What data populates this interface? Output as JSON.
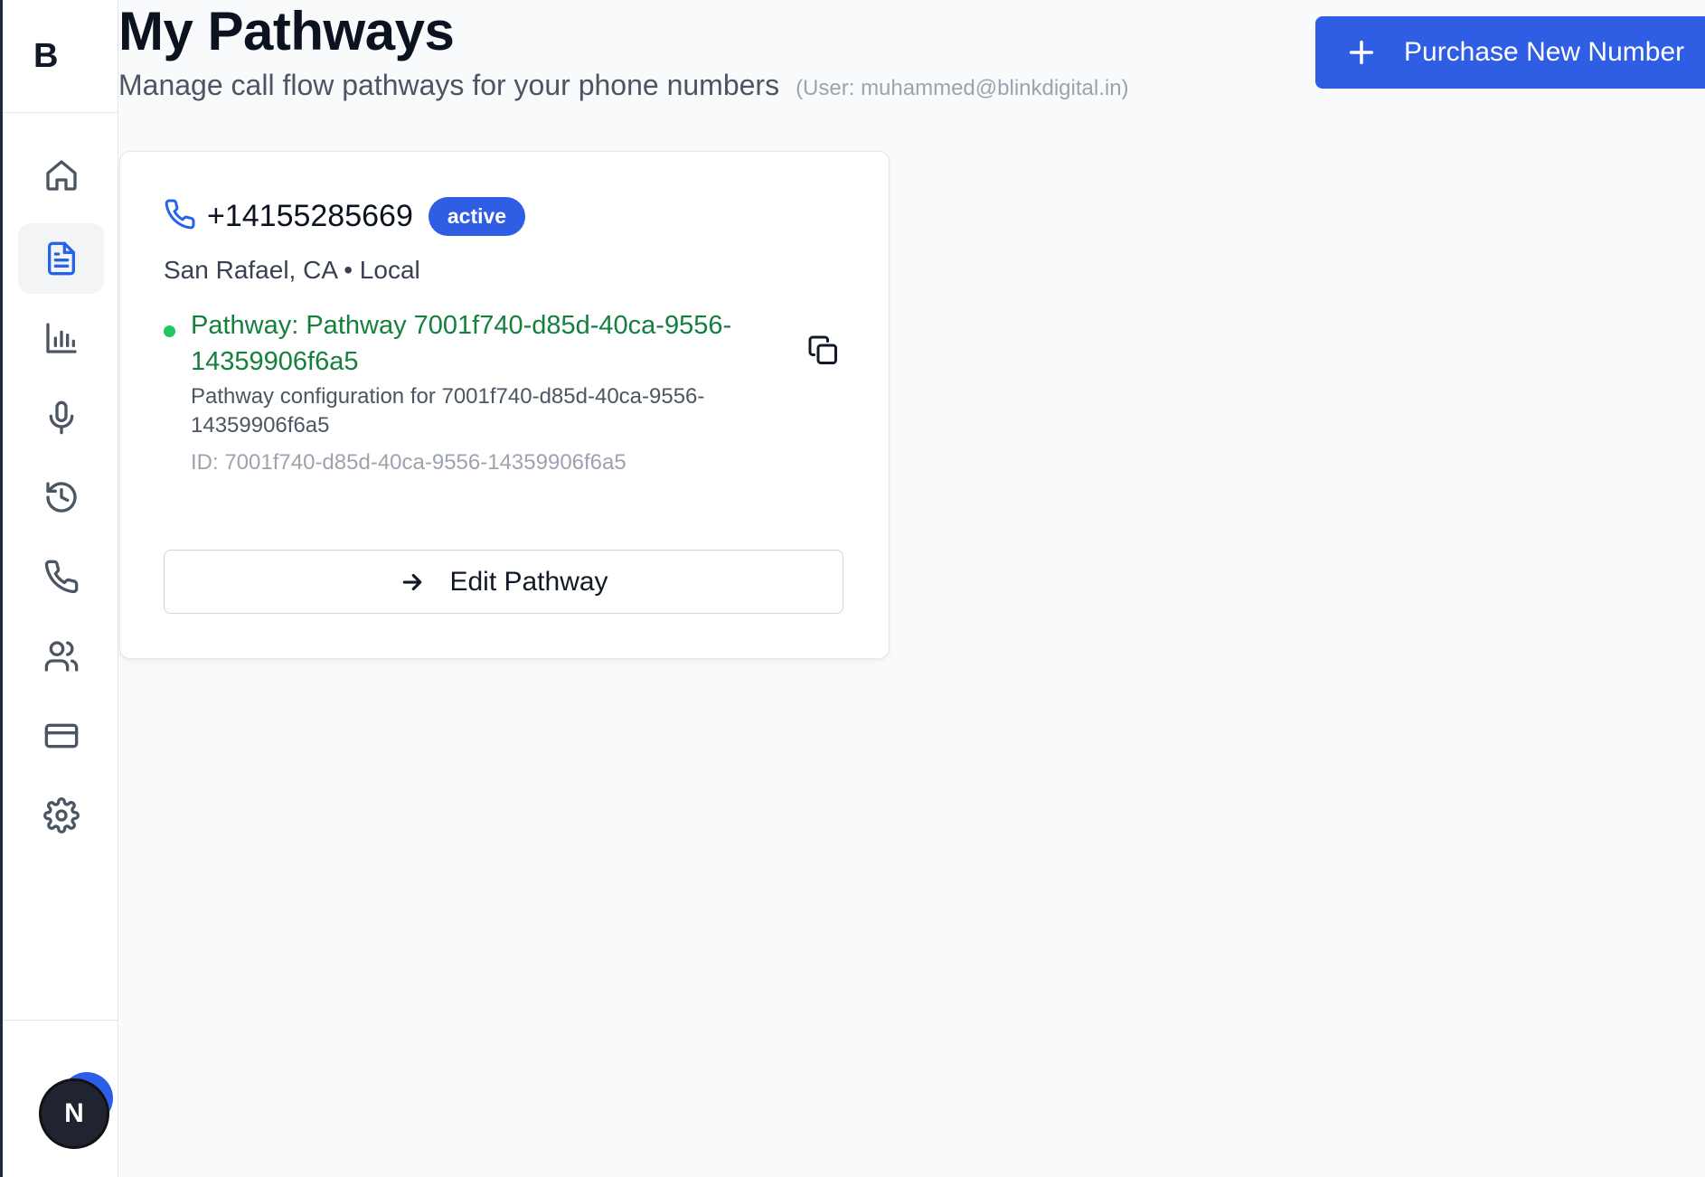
{
  "brand": {
    "logo_letter": "B"
  },
  "header": {
    "title": "My Pathways",
    "subtitle": "Manage call flow pathways for your phone numbers",
    "user_note": "(User: muhammed@blinkdigital.in)",
    "purchase_button_label": "Purchase New Number"
  },
  "sidebar": {
    "items": [
      {
        "icon": "home-icon",
        "active": false
      },
      {
        "icon": "document-icon",
        "active": true
      },
      {
        "icon": "bar-chart-icon",
        "active": false
      },
      {
        "icon": "microphone-icon",
        "active": false
      },
      {
        "icon": "history-icon",
        "active": false
      },
      {
        "icon": "phone-icon",
        "active": false
      },
      {
        "icon": "users-icon",
        "active": false
      },
      {
        "icon": "credit-card-icon",
        "active": false
      },
      {
        "icon": "gear-icon",
        "active": false
      }
    ],
    "avatar_letter": "N"
  },
  "card": {
    "phone_number": "+14155285669",
    "status": "active",
    "location": "San Rafael, CA • Local",
    "pathway_name": "Pathway: Pathway 7001f740-d85d-40ca-9556-14359906f6a5",
    "pathway_description": "Pathway configuration for 7001f740-d85d-40ca-9556-14359906f6a5",
    "pathway_id": "ID: 7001f740-d85d-40ca-9556-14359906f6a5",
    "edit_button_label": "Edit Pathway"
  },
  "colors": {
    "accent": "#2f5de4",
    "status_green": "#22c55e",
    "pathway_text": "#15803d"
  }
}
